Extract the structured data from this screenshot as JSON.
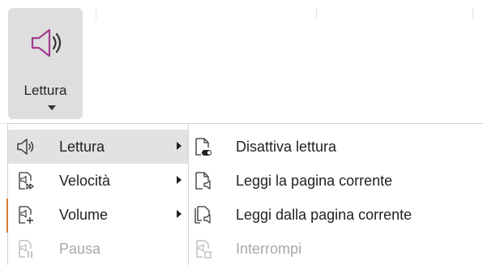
{
  "colors": {
    "ribbon_pressed": "#dedede",
    "menu_hover": "#e2e2e2",
    "text": "#222222",
    "disabled_text": "#a8a8a8",
    "accent_mark": "#e07a2c"
  },
  "ribbon": {
    "button": {
      "label": "Lettura",
      "icon": "speaker-icon"
    }
  },
  "main_menu": {
    "items": [
      {
        "label": "Lettura",
        "icon": "speaker-icon",
        "submenu": true,
        "active": true,
        "enabled": true
      },
      {
        "label": "Velocità",
        "icon": "reading-speed-icon",
        "submenu": true,
        "active": false,
        "enabled": true
      },
      {
        "label": "Volume",
        "icon": "volume-up-icon",
        "submenu": true,
        "active": false,
        "enabled": true
      },
      {
        "label": "Pausa",
        "icon": "pause-reading-icon",
        "submenu": false,
        "active": false,
        "enabled": false
      }
    ]
  },
  "sub_menu": {
    "items": [
      {
        "label": "Disattiva lettura",
        "icon": "page-toggle-off-icon",
        "enabled": true
      },
      {
        "label": "Leggi la pagina corrente",
        "icon": "read-current-page-icon",
        "enabled": true
      },
      {
        "label": "Leggi dalla pagina corrente",
        "icon": "read-from-current-page-icon",
        "enabled": true
      },
      {
        "label": "Interrompi",
        "icon": "stop-reading-icon",
        "enabled": false
      }
    ]
  }
}
